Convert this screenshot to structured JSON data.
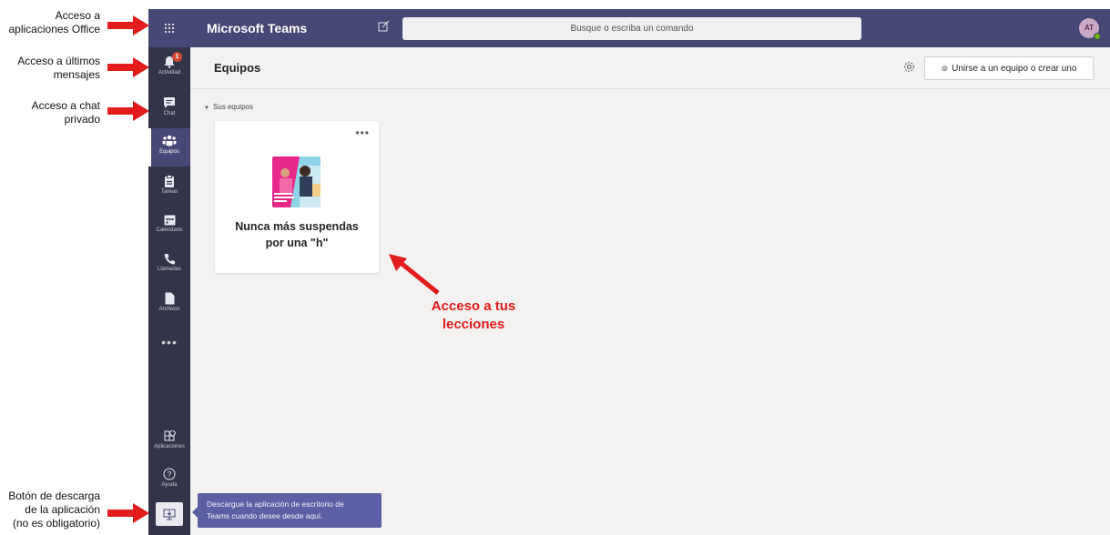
{
  "annotations": {
    "office_apps": [
      "Acceso a",
      "aplicaciones Office"
    ],
    "latest_messages": [
      "Acceso a últimos",
      "mensajes"
    ],
    "private_chat": [
      "Acceso a chat",
      "privado"
    ],
    "download": [
      "Botón de descarga",
      "de la aplicación",
      "(no es obligatorio)"
    ],
    "lessons": [
      "Acceso a tus",
      "lecciones"
    ]
  },
  "topbar": {
    "app_title": "Microsoft Teams",
    "search_placeholder": "Busque o escriba un comando",
    "avatar_initials": "AT"
  },
  "rail": {
    "activity": "Actividad",
    "activity_badge": "1",
    "chat": "Chat",
    "teams": "Equipos",
    "assignments": "Tareas",
    "calendar": "Calendario",
    "calls": "Llamadas",
    "files": "Archivos",
    "more": "•••",
    "apps": "Aplicaciones",
    "help": "Ayuda"
  },
  "header": {
    "title": "Equipos",
    "join_button": "Unirse a un equipo o crear uno"
  },
  "section": {
    "label": "Sus equipos"
  },
  "team_card": {
    "more": "•••",
    "name_line1": "Nunca más suspendas",
    "name_line2": "por una \"h\""
  },
  "tooltip": {
    "line1": "Descargue la aplicación de escritorio de",
    "line2": "Teams cuando desee desde aquí."
  },
  "colors": {
    "topbar": "#464775",
    "rail": "#33344a",
    "content": "#f3f2f1",
    "annotation_red": "#e21b1b",
    "tooltip": "#5b5fa3"
  }
}
